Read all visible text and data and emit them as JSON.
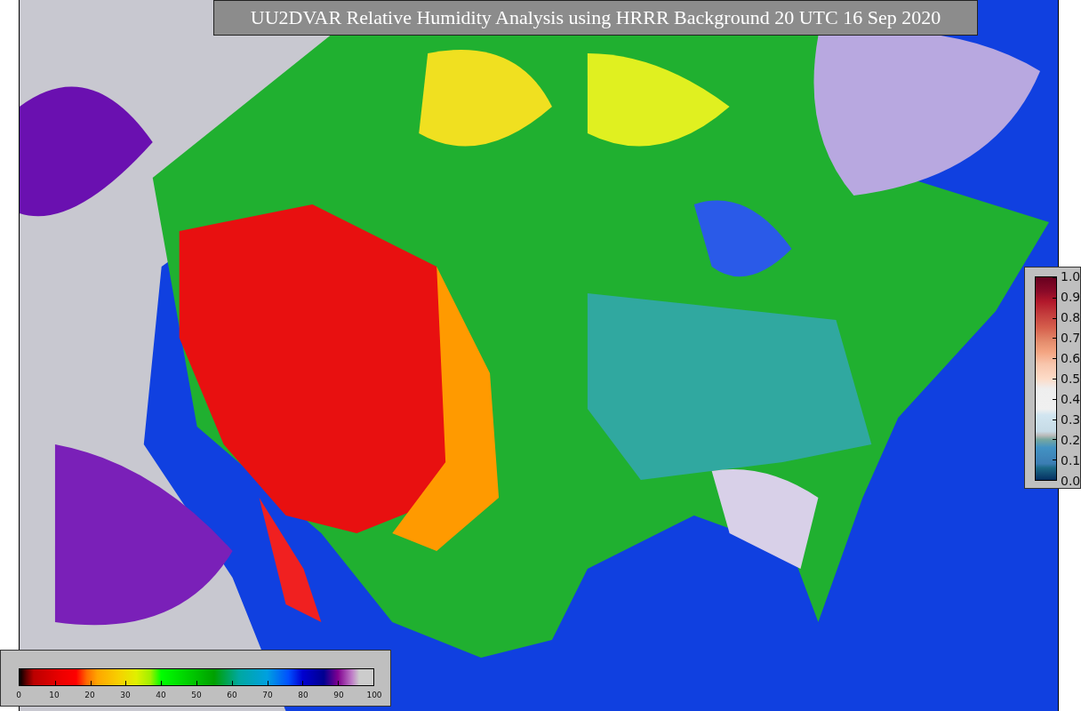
{
  "title": "UU2DVAR Relative Humidity Analysis using HRRR Background 20 UTC 16 Sep 2020",
  "horizontal_colorbar": {
    "ticks": [
      "0",
      "10",
      "20",
      "30",
      "40",
      "50",
      "60",
      "70",
      "80",
      "90",
      "100"
    ]
  },
  "vertical_colorbar": {
    "ticks": [
      "1.0",
      "0.9",
      "0.8",
      "0.7",
      "0.6",
      "0.5",
      "0.4",
      "0.3",
      "0.2",
      "0.1",
      "0.0"
    ]
  }
}
